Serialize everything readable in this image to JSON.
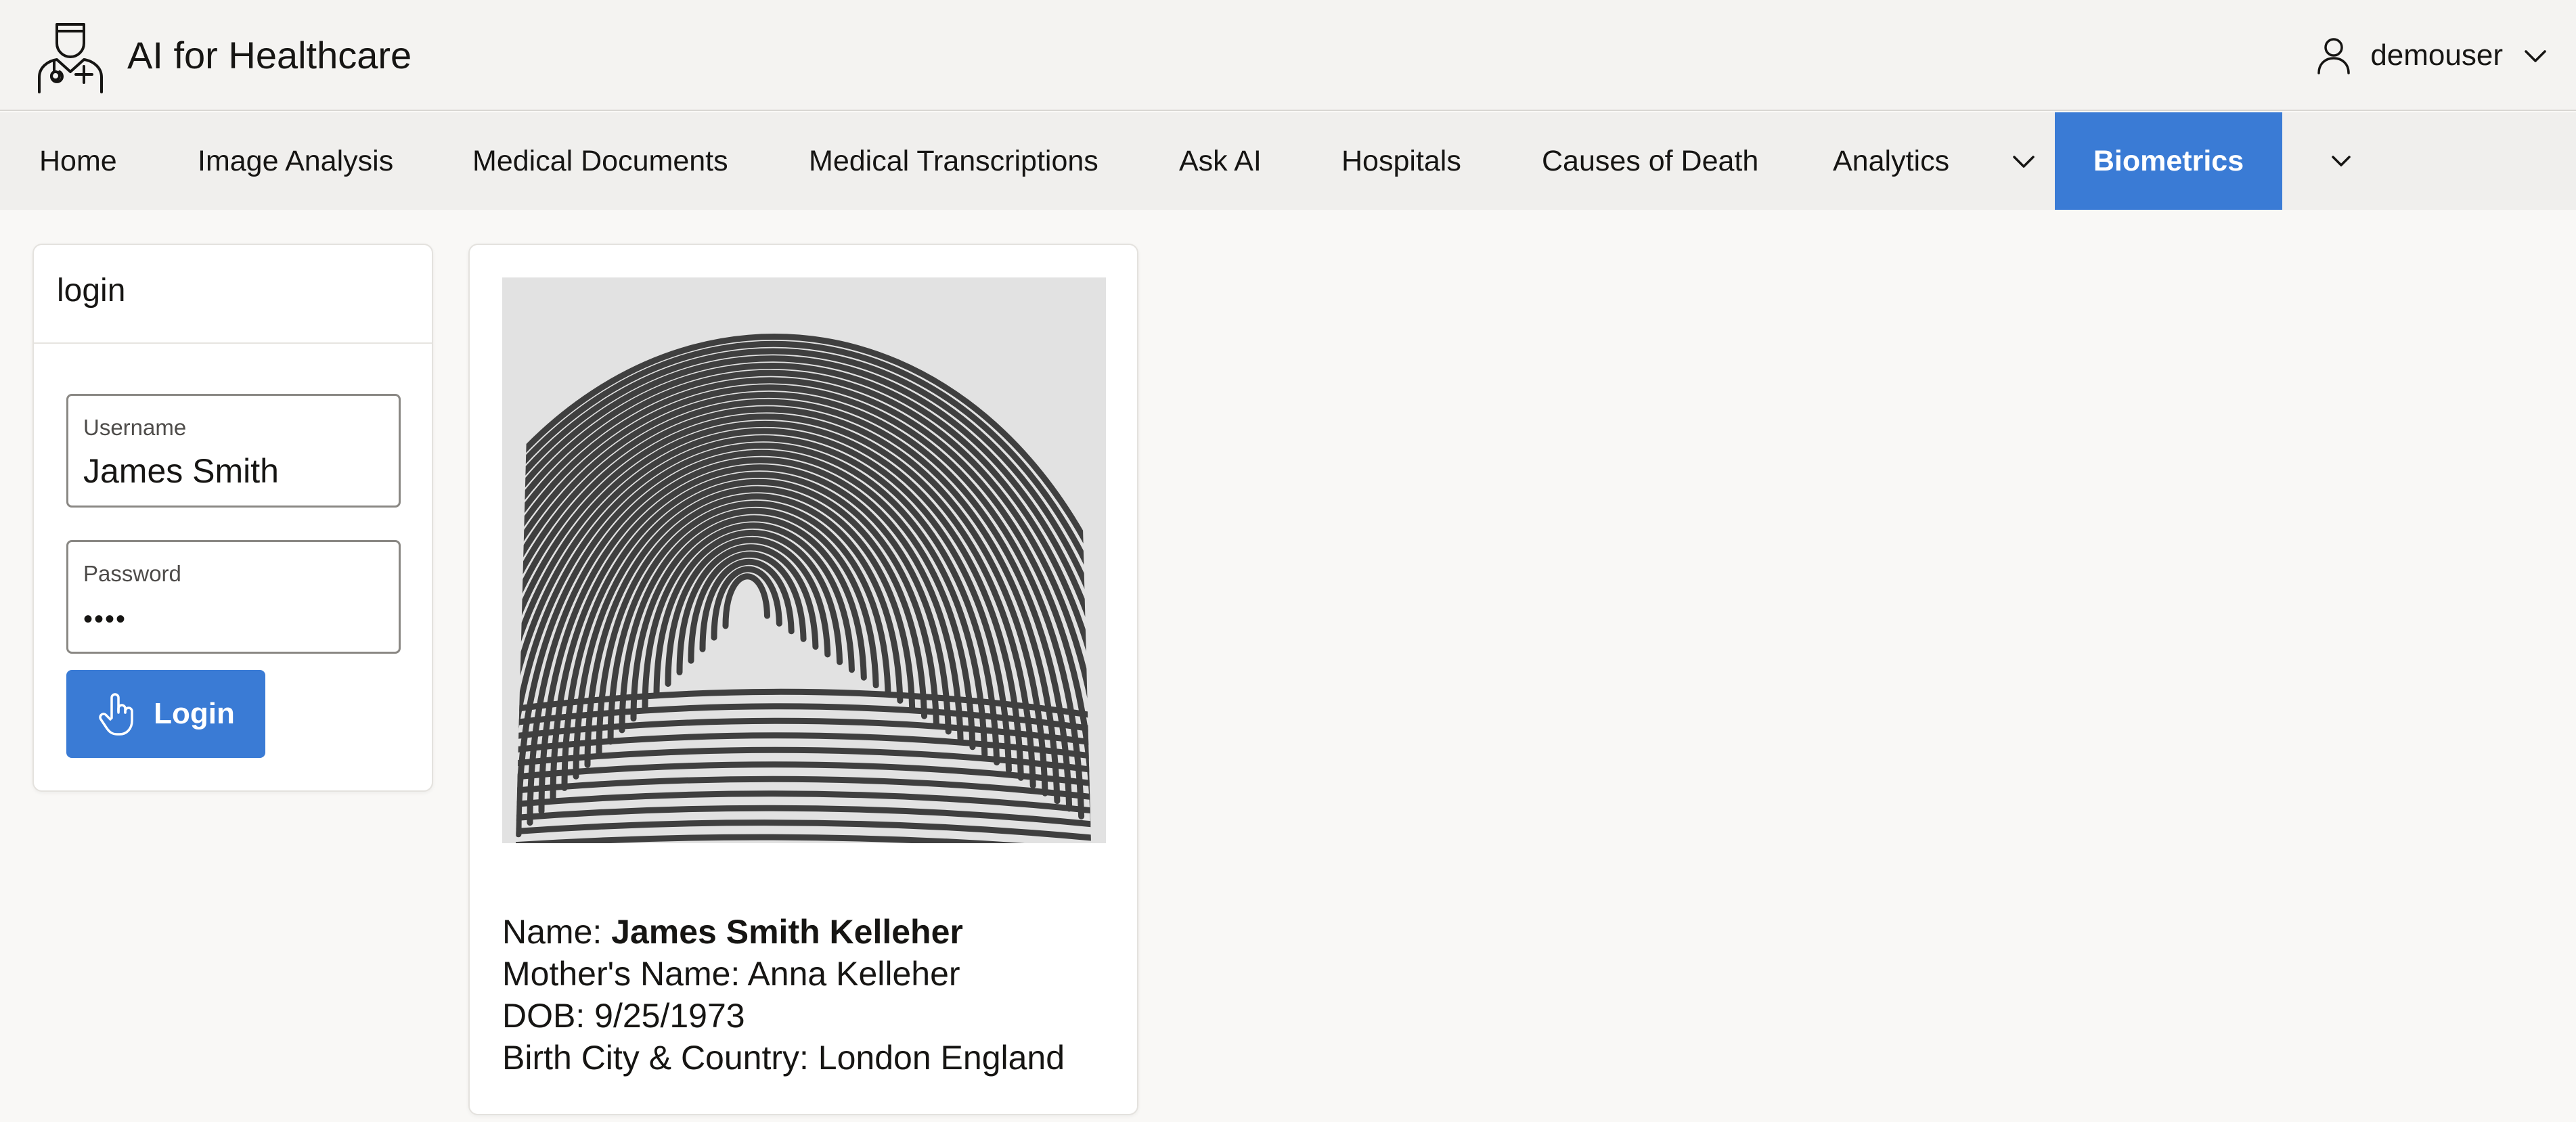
{
  "app": {
    "title": "AI for Healthcare",
    "logo_icon": "doctor-icon",
    "accent_color": "#3a7bd5"
  },
  "user": {
    "name": "demouser",
    "icon": "user-icon"
  },
  "nav": {
    "items": [
      {
        "label": "Home"
      },
      {
        "label": "Image Analysis"
      },
      {
        "label": "Medical Documents"
      },
      {
        "label": "Medical Transcriptions"
      },
      {
        "label": "Ask AI"
      },
      {
        "label": "Hospitals"
      },
      {
        "label": "Causes of Death"
      },
      {
        "label": "Analytics"
      }
    ],
    "active": {
      "label": "Biometrics"
    }
  },
  "login": {
    "title": "login",
    "username_label": "Username",
    "username_value": "James Smith",
    "password_label": "Password",
    "password_masked": "••••",
    "button_label": "Login",
    "button_icon": "hand-pointer-icon"
  },
  "biometric": {
    "image_icon": "fingerprint-image",
    "name_prefix": "Name: ",
    "name_value": "James Smith Kelleher",
    "mother_line": "Mother's Name: Anna Kelleher",
    "dob_line": "DOB: 9/25/1973",
    "birth_line": "Birth City & Country: London England"
  }
}
